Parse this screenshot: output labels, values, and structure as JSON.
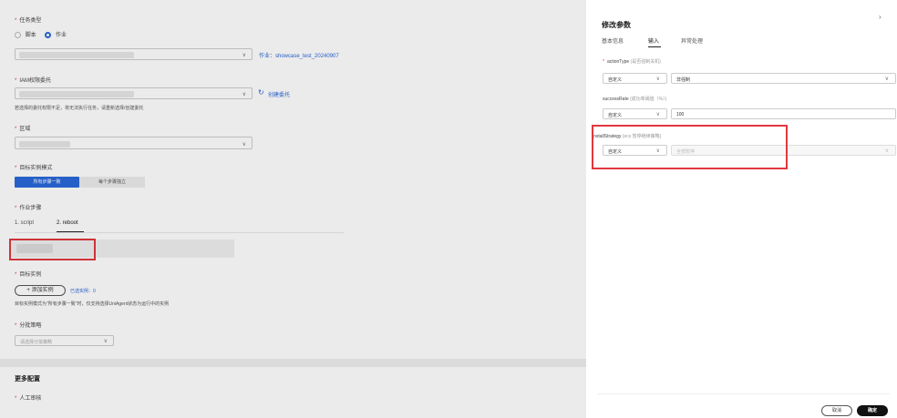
{
  "left": {
    "task_type": {
      "label": "任务类型",
      "options": [
        "脚本",
        "作业"
      ],
      "selected": "作业"
    },
    "job_link": "作业：showcase_test_20240907",
    "iam": {
      "label": "IAM权限委托",
      "create_link": "创建委托",
      "warning": "若选择的委托权限不足，将无法执行任务，请重新选择/创建委托"
    },
    "region": {
      "label": "区域"
    },
    "target_mode": {
      "label": "目标实例模式",
      "options": [
        "所有步骤一致",
        "每个步骤独立"
      ]
    },
    "job_steps": {
      "label": "作业步骤",
      "tabs": [
        "1. script",
        "2. reboot"
      ]
    },
    "target_instance": {
      "label": "目标实例",
      "add_button": "+ 添加实例",
      "selected_text": "已选实例：0",
      "note": "目标实例模式为\"所有步骤一致\"时，仅支持选择UniAgent状态为运行中的实例"
    },
    "batch": {
      "label": "分批策略",
      "placeholder": "请选择分批策略"
    },
    "more": {
      "title": "更多配置",
      "manual_review": "人工审核"
    }
  },
  "panel": {
    "title": "修改参数",
    "tabs": [
      "基本信息",
      "输入",
      "异常处理"
    ],
    "active_tab": "输入",
    "params": [
      {
        "name": "actionType",
        "hint": "(是否强制关机)",
        "required": true,
        "mode": "自定义",
        "value": "非强制"
      },
      {
        "name": "successRate",
        "hint": "(成功率阈值（%）)",
        "required": false,
        "mode": "自定义",
        "value": "100"
      },
      {
        "name": "installStrategy",
        "hint": "(ecs 暂停继续策略)",
        "required": false,
        "mode": "自定义",
        "value": "全部暂停"
      }
    ],
    "cancel": "取消",
    "confirm": "确定"
  },
  "colors": {
    "accent": "#2a68d9",
    "required": "#e0383e",
    "highlight": "#e0383e"
  }
}
